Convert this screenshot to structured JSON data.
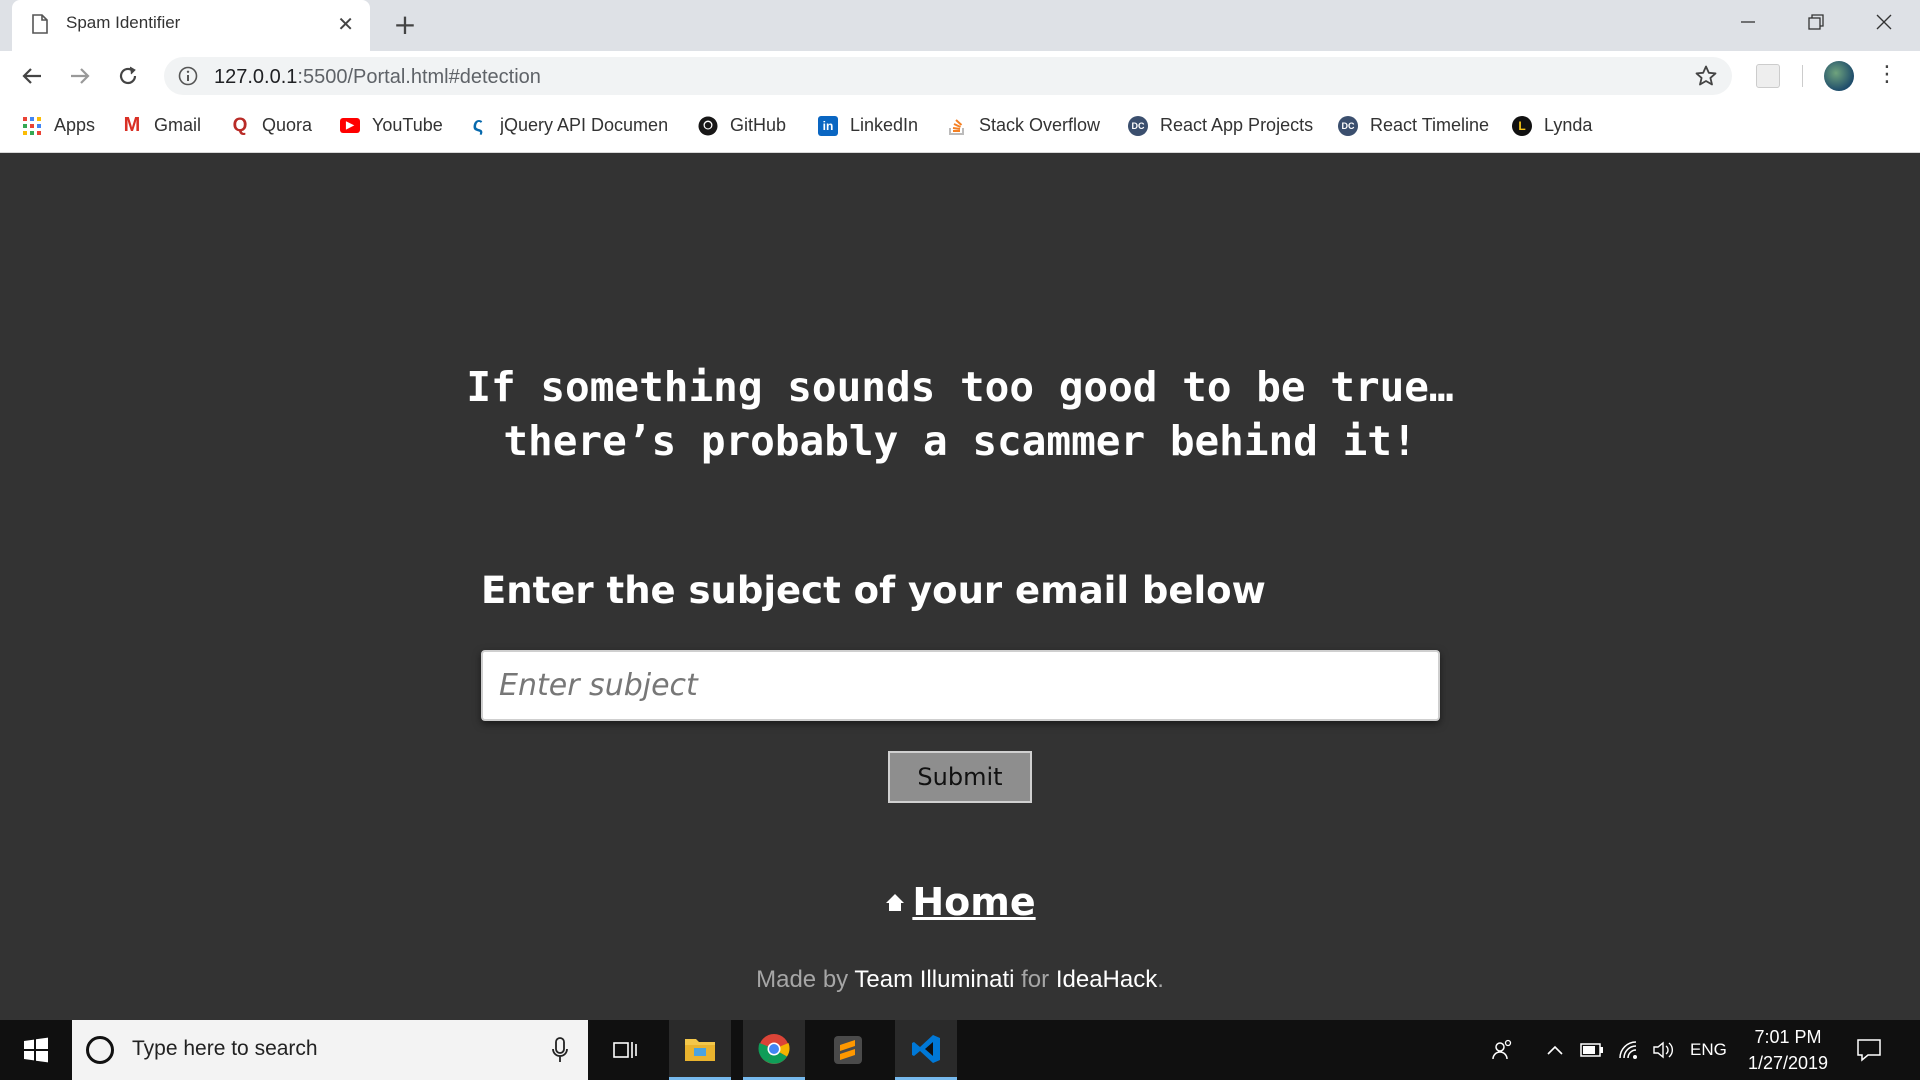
{
  "browser": {
    "tab_title": "Spam Identifier",
    "url_host": "127.0.0.1",
    "url_rest": ":5500/Portal.html#detection"
  },
  "bookmarks": [
    {
      "label": "Apps",
      "icon": "apps-grid-icon"
    },
    {
      "label": "Gmail",
      "icon": "gmail-icon"
    },
    {
      "label": "Quora",
      "icon": "quora-icon"
    },
    {
      "label": "YouTube",
      "icon": "youtube-icon"
    },
    {
      "label": "jQuery API Documen",
      "icon": "jquery-icon"
    },
    {
      "label": "GitHub",
      "icon": "github-icon"
    },
    {
      "label": "LinkedIn",
      "icon": "linkedin-icon"
    },
    {
      "label": "Stack Overflow",
      "icon": "stackoverflow-icon"
    },
    {
      "label": "React App Projects",
      "icon": "dc-icon"
    },
    {
      "label": "React Timeline",
      "icon": "dc-icon"
    },
    {
      "label": "Lynda",
      "icon": "lynda-icon"
    }
  ],
  "page": {
    "home_label": "Home",
    "tagline_line1": "If something sounds too good to be true…",
    "tagline_line2": "there’s probably a scammer behind it!",
    "prompt": "Enter the subject of your email below",
    "input_placeholder": "Enter subject",
    "submit_label": "Submit",
    "credits": {
      "made_by": "Made by",
      "team": "Team Illuminati",
      "for": "for",
      "event": "IdeaHack",
      "period": "."
    }
  },
  "taskbar": {
    "search_placeholder": "Type here to search",
    "language": "ENG",
    "time": "7:01 PM",
    "date": "1/27/2019"
  },
  "colors": {
    "page_bg": "#333333",
    "text": "#ffffff",
    "button_bg": "#8e8e8e"
  }
}
